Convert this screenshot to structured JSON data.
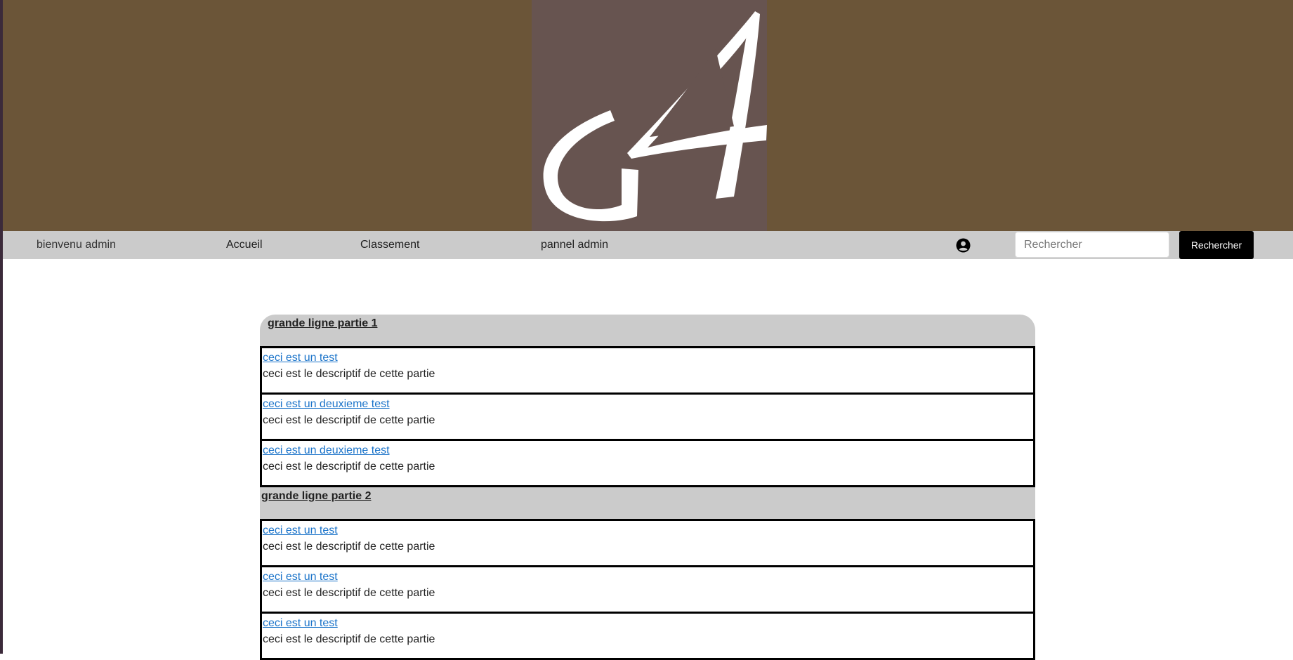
{
  "logo": {
    "text": "G4"
  },
  "nav": {
    "welcome": "bienvenu admin",
    "home": "Accueil",
    "ranking": "Classement",
    "admin_panel": "pannel admin",
    "user_icon": "user-circle-icon"
  },
  "search": {
    "placeholder": "Rechercher",
    "button_label": "Rechercher"
  },
  "sections": [
    {
      "title": "grande ligne partie 1",
      "topics": [
        {
          "title": "ceci est un test",
          "description": "ceci est le descriptif de cette partie"
        },
        {
          "title": "ceci est un deuxieme test",
          "description": "ceci est le descriptif de cette partie"
        },
        {
          "title": "ceci est un deuxieme test",
          "description": "ceci est le descriptif de cette partie"
        }
      ]
    },
    {
      "title": "grande ligne partie 2",
      "topics": [
        {
          "title": "ceci est un test",
          "description": "ceci est le descriptif de cette partie"
        },
        {
          "title": "ceci est un test",
          "description": "ceci est le descriptif de cette partie"
        },
        {
          "title": "ceci est un test",
          "description": "ceci est le descriptif de cette partie"
        }
      ]
    }
  ],
  "colors": {
    "banner": "#6b5538",
    "logo_background": "#675450",
    "navbar": "#cbcbcb",
    "link": "#1a73c9",
    "search_button": "#000000"
  }
}
